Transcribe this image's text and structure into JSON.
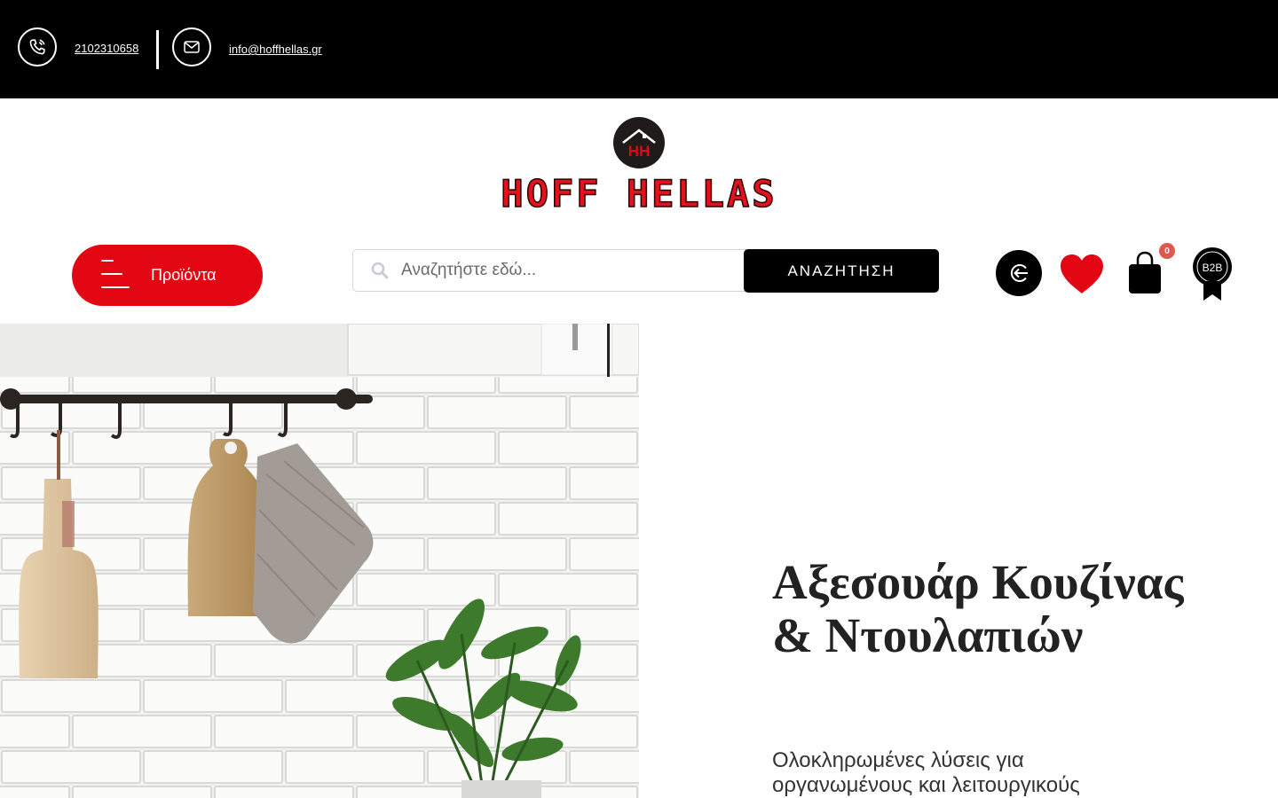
{
  "topbar": {
    "phone": "2102310658",
    "email": "info@hoffhellas.gr"
  },
  "logo": {
    "text": "HOFF HELLAS",
    "badge_text": "HH"
  },
  "nav": {
    "products_label": "Προϊόντα"
  },
  "search": {
    "placeholder": "Αναζητήστε εδώ...",
    "button_label": "ΑΝΑΖΗΤΗΣΗ"
  },
  "header_icons": {
    "login": "login-icon",
    "wishlist": "heart-icon",
    "cart": "bag-icon",
    "cart_count": "0",
    "b2b_label": "B2B"
  },
  "hero": {
    "title": "Αξεσουάρ Κουζίνας & Ντουλαπιών",
    "description": "Ολοκληρωμένες λύσεις για οργανωμένους και λειτουργικούς"
  },
  "colors": {
    "brand_red": "#e30613",
    "topbar_bg": "#000000",
    "badge_red": "#e05650"
  }
}
